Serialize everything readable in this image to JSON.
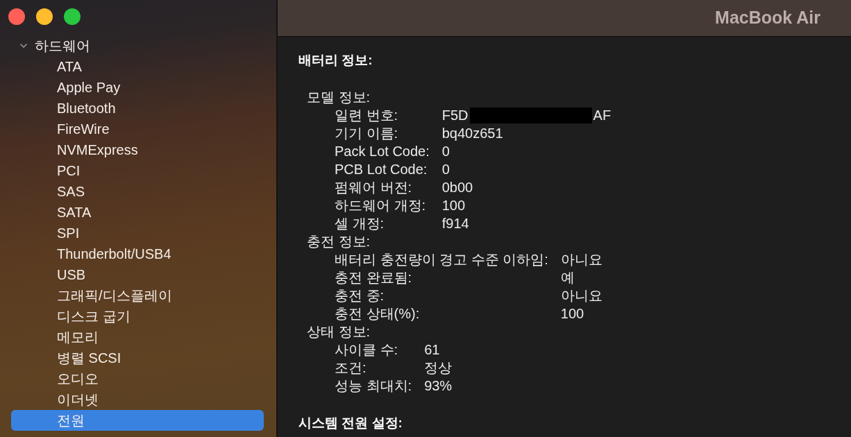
{
  "window": {
    "title": "MacBook Air"
  },
  "sidebar": {
    "items": [
      {
        "label": "하드웨어",
        "expanded": true,
        "selected": false,
        "children": [
          {
            "label": "ATA",
            "selected": false
          },
          {
            "label": "Apple Pay",
            "selected": false
          },
          {
            "label": "Bluetooth",
            "selected": false
          },
          {
            "label": "FireWire",
            "selected": false
          },
          {
            "label": "NVMExpress",
            "selected": false
          },
          {
            "label": "PCI",
            "selected": false
          },
          {
            "label": "SAS",
            "selected": false
          },
          {
            "label": "SATA",
            "selected": false
          },
          {
            "label": "SPI",
            "selected": false
          },
          {
            "label": "Thunderbolt/USB4",
            "selected": false
          },
          {
            "label": "USB",
            "selected": false
          },
          {
            "label": "그래픽/디스플레이",
            "selected": false
          },
          {
            "label": "디스크 굽기",
            "selected": false
          },
          {
            "label": "메모리",
            "selected": false
          },
          {
            "label": "병렬 SCSI",
            "selected": false
          },
          {
            "label": "오디오",
            "selected": false
          },
          {
            "label": "이더넷",
            "selected": false
          },
          {
            "label": "전원",
            "selected": true
          }
        ]
      }
    ]
  },
  "content": {
    "sections": [
      {
        "title": "배터리 정보:",
        "groups": [
          {
            "title": "모델 정보:",
            "rows": [
              {
                "label": "일련 번호:",
                "value": "F5D",
                "redacted": true,
                "value_after_redaction": "AF"
              },
              {
                "label": "기기 이름:",
                "value": "bq40z651",
                "redacted": false
              },
              {
                "label": "Pack Lot Code:",
                "value": "0",
                "redacted": false
              },
              {
                "label": "PCB Lot Code:",
                "value": "0",
                "redacted": false
              },
              {
                "label": "펌웨어 버전:",
                "value": "0b00",
                "redacted": false
              },
              {
                "label": "하드웨어 개정:",
                "value": "100",
                "redacted": false
              },
              {
                "label": "셀 개정:",
                "value": "f914",
                "redacted": false
              }
            ]
          },
          {
            "title": "충전 정보:",
            "rows": [
              {
                "label": "배터리 충전량이 경고 수준 이하임:",
                "value": "아니요",
                "redacted": false
              },
              {
                "label": "충전 완료됨:",
                "value": "예",
                "redacted": false
              },
              {
                "label": "충전 중:",
                "value": "아니요",
                "redacted": false
              },
              {
                "label": "충전 상태(%):",
                "value": "100",
                "redacted": false
              }
            ]
          },
          {
            "title": "상태 정보:",
            "rows": [
              {
                "label": "사이클 수:",
                "value": "61",
                "redacted": false
              },
              {
                "label": "조건:",
                "value": "정상",
                "redacted": false
              },
              {
                "label": "성능 최대치:",
                "value": "93%",
                "redacted": false
              }
            ]
          }
        ]
      },
      {
        "title": "시스템 전원 설정:"
      }
    ]
  }
}
